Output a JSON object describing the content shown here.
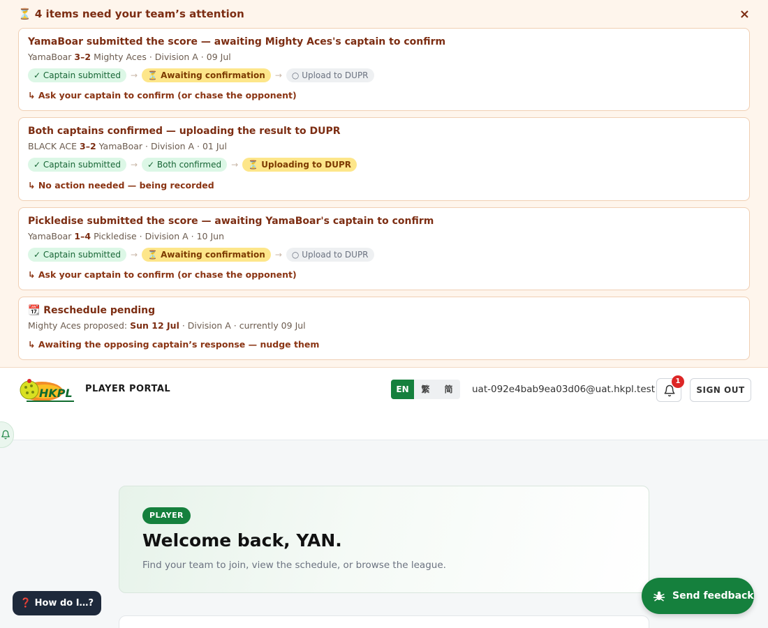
{
  "banner": {
    "title": "⏳ 4 items need your team’s attention",
    "close_label": "×",
    "cards": [
      {
        "headline": "YamaBoar submitted the score — awaiting Mighty Aces's captain to confirm",
        "home": "YamaBoar",
        "score": "3–2",
        "away": "Mighty Aces",
        "detail": " · Division A · 09 Jul",
        "steps": [
          {
            "label": "✓ Captain submitted",
            "state": "done"
          },
          {
            "label": "⏳ Awaiting confirmation",
            "state": "wait"
          },
          {
            "label": "○ Upload to DUPR",
            "state": "todo"
          }
        ],
        "action": "↳ Ask your captain to confirm (or chase the opponent)"
      },
      {
        "headline": "Both captains confirmed — uploading the result to DUPR",
        "home": "BLACK ACE",
        "score": "3–2",
        "away": "YamaBoar",
        "detail": " · Division A · 01 Jul",
        "steps": [
          {
            "label": "✓ Captain submitted",
            "state": "done"
          },
          {
            "label": "✓ Both confirmed",
            "state": "done"
          },
          {
            "label": "⏳ Uploading to DUPR",
            "state": "wait"
          }
        ],
        "action": "↳ No action needed — being recorded"
      },
      {
        "headline": "Pickledise submitted the score — awaiting YamaBoar's captain to confirm",
        "home": "YamaBoar",
        "score": "1–4",
        "away": "Pickledise",
        "detail": " · Division A · 10 Jun",
        "steps": [
          {
            "label": "✓ Captain submitted",
            "state": "done"
          },
          {
            "label": "⏳ Awaiting confirmation",
            "state": "wait"
          },
          {
            "label": "○ Upload to DUPR",
            "state": "todo"
          }
        ],
        "action": "↳ Ask your captain to confirm (or chase the opponent)"
      }
    ],
    "reschedule": {
      "headline": "📆 Reschedule pending",
      "proposer": "Mighty Aces proposed: ",
      "date": "Sun 12 Jul",
      "detail": " · Division A · currently 09 Jul",
      "action": "↳ Awaiting the opposing captain’s response — nudge them"
    },
    "arrow": "→"
  },
  "header": {
    "portal_title": "PLAYER PORTAL",
    "languages": [
      "EN",
      "繁",
      "简"
    ],
    "active_language": "EN",
    "email": "uat-092e4bab9ea03d06@uat.hkpl.test",
    "notification_count": "1",
    "signout_label": "SIGN OUT"
  },
  "welcome": {
    "role": "PLAYER",
    "title": "Welcome back, YAN.",
    "subtitle": "Find your team to join, view the schedule, or browse the league."
  },
  "floating": {
    "help_label": "❓ How do I…?",
    "feedback_label": "Send feedback"
  },
  "colors": {
    "accent": "#15803d",
    "banner_bg": "#fef5ec",
    "banner_text": "#7c2d12",
    "badge": "#dc2626"
  }
}
